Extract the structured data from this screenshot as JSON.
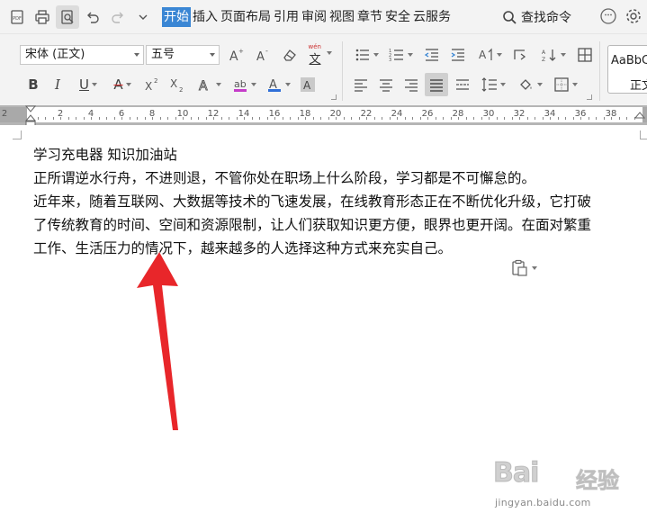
{
  "menubar": {
    "tabs": [
      {
        "label": "开始",
        "active": true
      },
      {
        "label": "插入"
      },
      {
        "label": "页面布局"
      },
      {
        "label": "引用"
      },
      {
        "label": "审阅"
      },
      {
        "label": "视图"
      },
      {
        "label": "章节"
      },
      {
        "label": "安全"
      },
      {
        "label": "云服务"
      }
    ],
    "search_label": "查找命令",
    "accent_color": "#3a86d4"
  },
  "ribbon": {
    "font_name": "宋体 (正文)",
    "font_size": "五号",
    "style_preview_1": "AaBbC",
    "style_preview_2": "正文",
    "phonetic_glyph": "文",
    "phonetic_top": "wén"
  },
  "ruler": {
    "numbers": [
      "2",
      "2",
      "4",
      "6",
      "8",
      "10",
      "12",
      "14",
      "16",
      "18",
      "20",
      "22",
      "24",
      "26",
      "28",
      "30",
      "32",
      "34",
      "36",
      "38"
    ]
  },
  "document": {
    "lines": [
      "学习充电器 知识加油站",
      "正所谓逆水行舟，不进则退，不管你处在职场上什么阶段，学习都是不可懈怠的。",
      "近年来，随着互联网、大数据等技术的飞速发展，在线教育形态正在不断优化升级，它打破",
      "了传统教育的时间、空间和资源限制，让人们获取知识更方便，眼界也更开阔。在面对繁重",
      "工作、生活压力的情况下，越来越多的人选择这种方式来充实自己。"
    ]
  },
  "annotation": {
    "color": "#e8262a"
  },
  "watermark": {
    "logo": "Bai",
    "logo_suffix": "经验",
    "url": "jingyan.baidu.com"
  }
}
